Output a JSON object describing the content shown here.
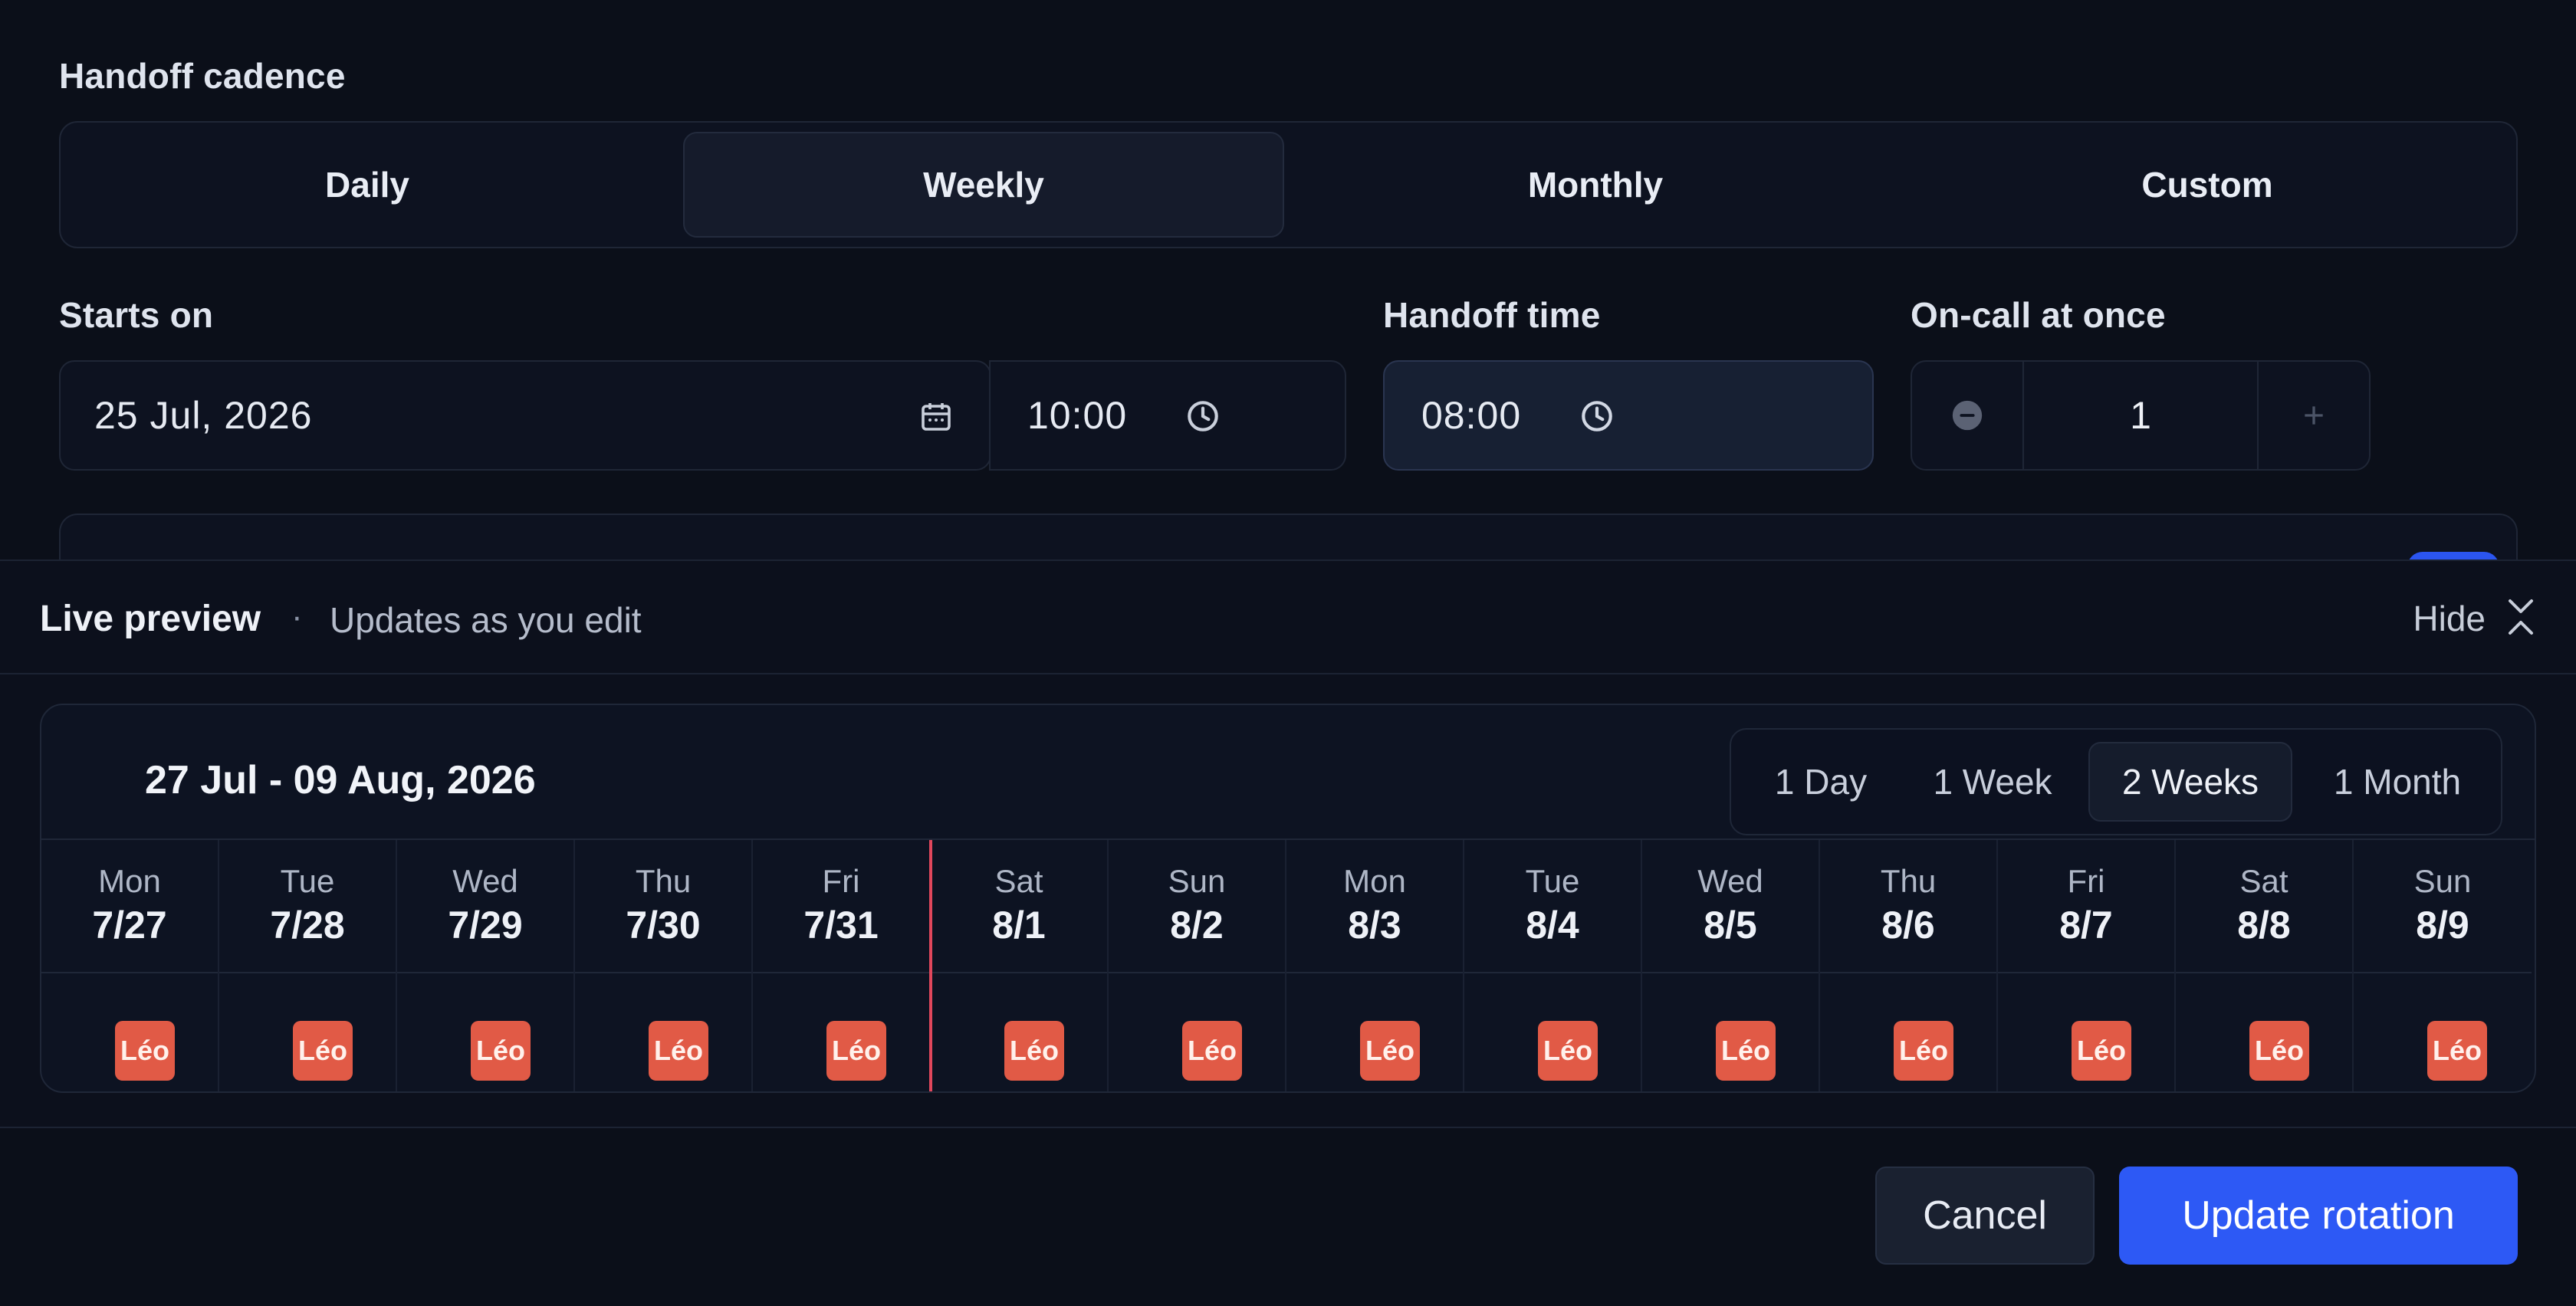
{
  "cadence": {
    "label": "Handoff cadence",
    "options": [
      "Daily",
      "Weekly",
      "Monthly",
      "Custom"
    ],
    "selected": "Weekly"
  },
  "starts_on": {
    "label": "Starts on",
    "date": "25 Jul, 2026",
    "time": "10:00"
  },
  "handoff_time": {
    "label": "Handoff time",
    "value": "08:00"
  },
  "oncall": {
    "label": "On-call at once",
    "value": "1"
  },
  "preview": {
    "title": "Live preview",
    "separator": "·",
    "subtitle": "Updates as you edit",
    "hide_label": "Hide",
    "range_label": "27 Jul - 09 Aug, 2026",
    "range_options": [
      "1 Day",
      "1 Week",
      "2 Weeks",
      "1 Month"
    ],
    "range_selected": "2 Weeks",
    "days": [
      {
        "name": "Mon",
        "date": "7/27",
        "assignee": "Léo"
      },
      {
        "name": "Tue",
        "date": "7/28",
        "assignee": "Léo"
      },
      {
        "name": "Wed",
        "date": "7/29",
        "assignee": "Léo"
      },
      {
        "name": "Thu",
        "date": "7/30",
        "assignee": "Léo"
      },
      {
        "name": "Fri",
        "date": "7/31",
        "assignee": "Léo"
      },
      {
        "name": "Sat",
        "date": "8/1",
        "assignee": "Léo"
      },
      {
        "name": "Sun",
        "date": "8/2",
        "assignee": "Léo"
      },
      {
        "name": "Mon",
        "date": "8/3",
        "assignee": "Léo"
      },
      {
        "name": "Tue",
        "date": "8/4",
        "assignee": "Léo"
      },
      {
        "name": "Wed",
        "date": "8/5",
        "assignee": "Léo"
      },
      {
        "name": "Thu",
        "date": "8/6",
        "assignee": "Léo"
      },
      {
        "name": "Fri",
        "date": "8/7",
        "assignee": "Léo"
      },
      {
        "name": "Sat",
        "date": "8/8",
        "assignee": "Léo"
      },
      {
        "name": "Sun",
        "date": "8/9",
        "assignee": "Léo"
      }
    ],
    "today_index": 5,
    "assignee_color": "#e15a46",
    "today_line_color": "#e0475c"
  },
  "footer": {
    "cancel_label": "Cancel",
    "submit_label": "Update rotation"
  },
  "colors": {
    "accent": "#2d59f5",
    "background": "#0b0f19"
  }
}
